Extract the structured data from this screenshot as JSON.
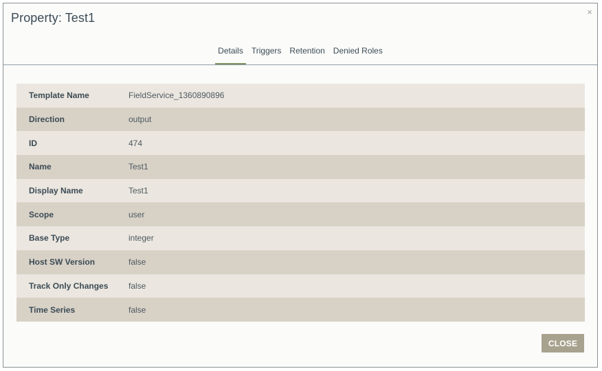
{
  "dialog": {
    "title": "Property: Test1",
    "close_icon": "×"
  },
  "tabs": [
    {
      "label": "Details",
      "active": true
    },
    {
      "label": "Triggers",
      "active": false
    },
    {
      "label": "Retention",
      "active": false
    },
    {
      "label": "Denied Roles",
      "active": false
    }
  ],
  "details": [
    {
      "label": "Template Name",
      "value": "FieldService_1360890896"
    },
    {
      "label": "Direction",
      "value": "output"
    },
    {
      "label": "ID",
      "value": "474"
    },
    {
      "label": "Name",
      "value": "Test1"
    },
    {
      "label": "Display Name",
      "value": "Test1"
    },
    {
      "label": "Scope",
      "value": "user"
    },
    {
      "label": "Base Type",
      "value": "integer"
    },
    {
      "label": "Host SW Version",
      "value": "false"
    },
    {
      "label": "Track Only Changes",
      "value": "false"
    },
    {
      "label": "Time Series",
      "value": "false"
    }
  ],
  "footer": {
    "close_label": "CLOSE"
  },
  "colors": {
    "accent": "#7d8f5a",
    "row_light": "#ebe6df",
    "row_dark": "#d8d1c6",
    "button": "#a7a28e"
  }
}
